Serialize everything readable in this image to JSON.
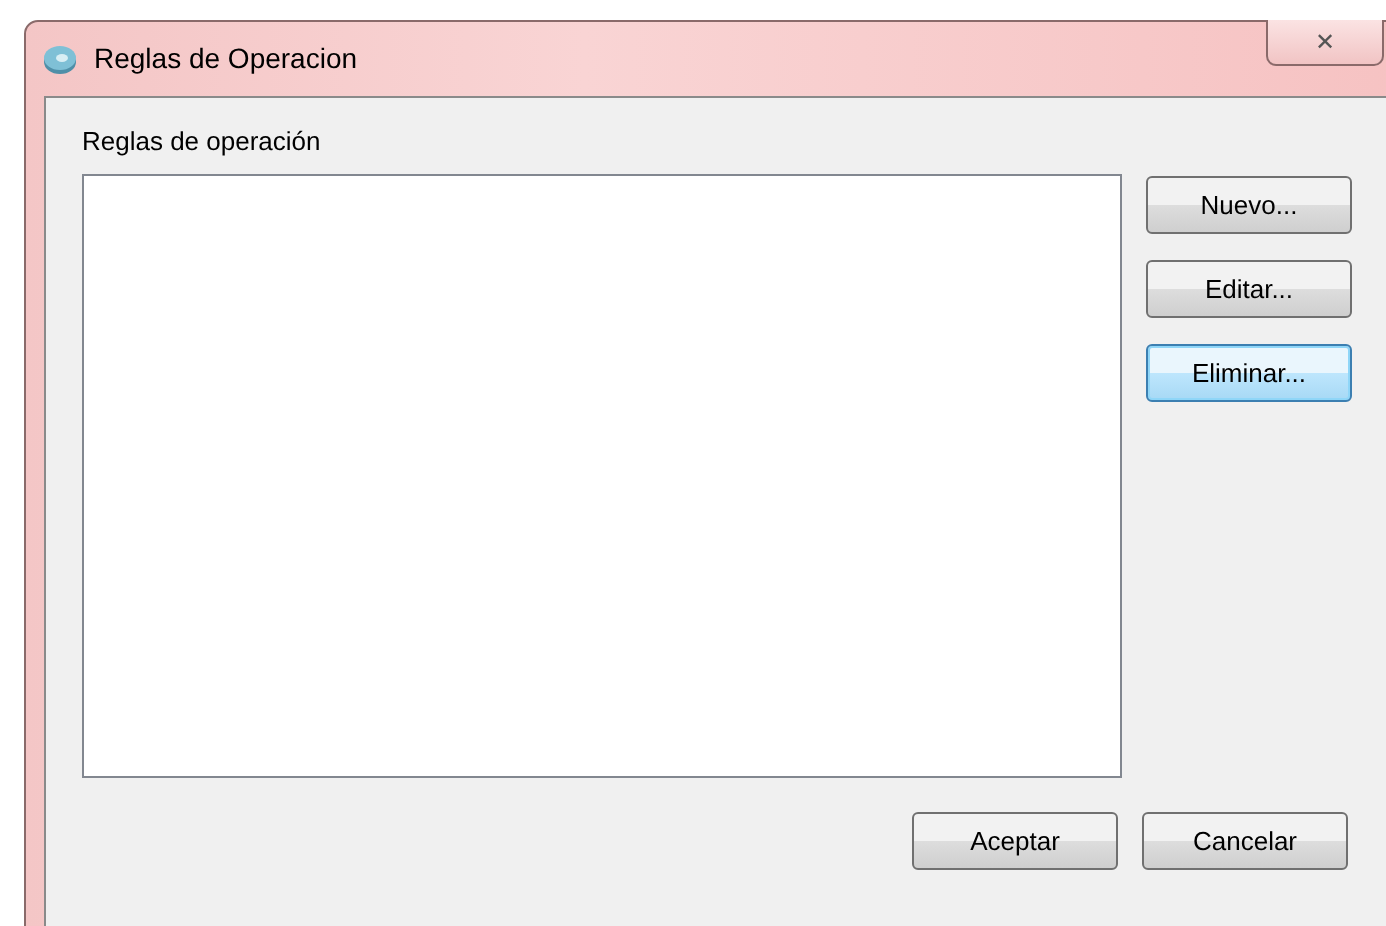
{
  "window": {
    "title": "Reglas de Operacion",
    "close_label": "✕"
  },
  "group_label": "Reglas de operación",
  "side_buttons": [
    {
      "label": "Nuevo...",
      "focused": false
    },
    {
      "label": "Editar...",
      "focused": false
    },
    {
      "label": "Eliminar...",
      "focused": true
    }
  ],
  "footer_buttons": [
    {
      "label": "Aceptar",
      "focused": false
    },
    {
      "label": "Cancelar",
      "focused": false
    }
  ]
}
